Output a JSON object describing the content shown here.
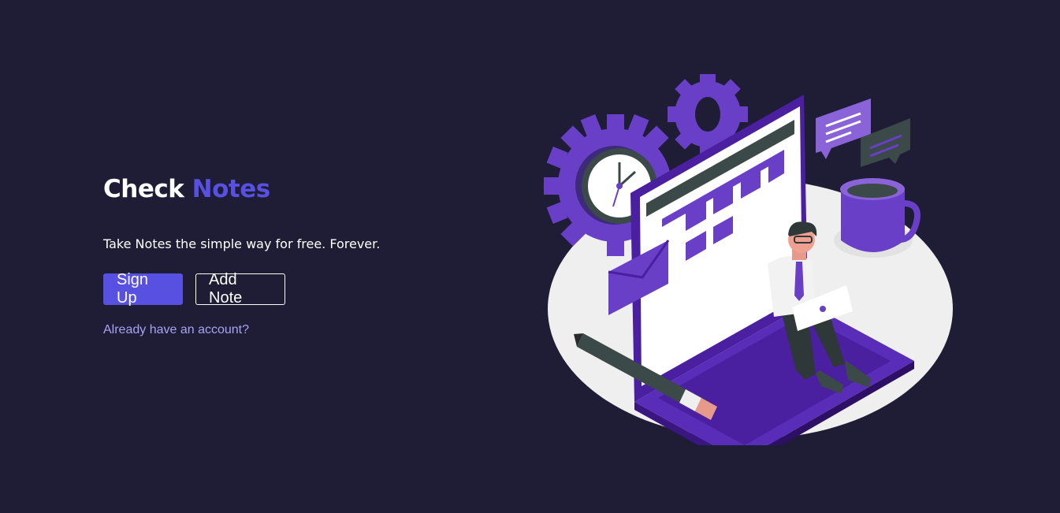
{
  "hero": {
    "title_part1": "Check",
    "title_part2": "Notes",
    "tagline": "Take Notes the simple way for free. Forever.",
    "signup_label": "Sign Up",
    "add_note_label": "Add Note",
    "login_link": "Already have an account?"
  },
  "colors": {
    "background": "#1e1d35",
    "accent": "#5850e0",
    "link": "#a8a3f5",
    "illustration_purple": "#6a3fc8",
    "illustration_dark_purple": "#4a1fa0",
    "illustration_floor": "#efefef"
  },
  "illustration": {
    "name": "person-working-on-laptop-illustration",
    "icons": [
      "gear-icon",
      "clock-icon",
      "laptop-icon",
      "chat-bubble-icon",
      "coffee-mug-icon",
      "envelope-icon",
      "pencil-icon"
    ]
  }
}
